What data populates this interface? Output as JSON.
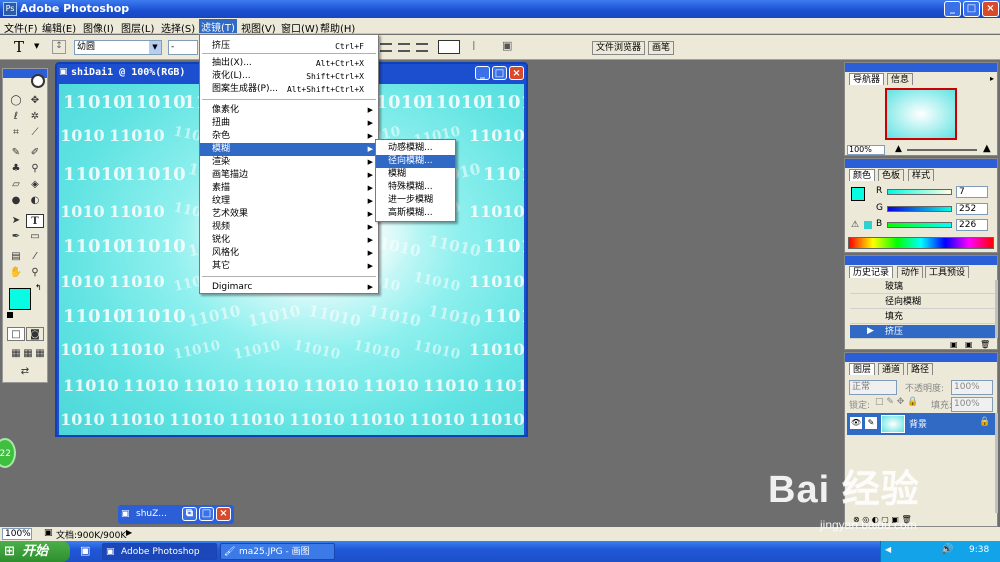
{
  "window": {
    "title": "Adobe Photoshop",
    "icon": "photoshop-icon"
  },
  "menubar": [
    "文件(F)",
    "编辑(E)",
    "图像(I)",
    "图层(L)",
    "选择(S)",
    "滤镜(T)",
    "视图(V)",
    "窗口(W)",
    "帮助(H)"
  ],
  "optionsbar": {
    "tool_glyph": "T",
    "font_family": "幼圆",
    "font_style": "-",
    "palette_tabs": [
      "文件浏览器",
      "画笔"
    ]
  },
  "document": {
    "title": "shiDai1 @ 100%(RGB)",
    "binary_text": "11010"
  },
  "filter_menu": {
    "items": [
      {
        "label": "挤压",
        "shortcut": "Ctrl+F"
      },
      {
        "label": "抽出(X)...",
        "shortcut": "Alt+Ctrl+X"
      },
      {
        "label": "液化(L)...",
        "shortcut": "Shift+Ctrl+X"
      },
      {
        "label": "图案生成器(P)...",
        "shortcut": "Alt+Shift+Ctrl+X"
      },
      {
        "label": "像素化"
      },
      {
        "label": "扭曲"
      },
      {
        "label": "杂色"
      },
      {
        "label": "模糊"
      },
      {
        "label": "渲染"
      },
      {
        "label": "画笔描边"
      },
      {
        "label": "素描"
      },
      {
        "label": "纹理"
      },
      {
        "label": "艺术效果"
      },
      {
        "label": "视频"
      },
      {
        "label": "锐化"
      },
      {
        "label": "风格化"
      },
      {
        "label": "其它"
      },
      {
        "label": "Digimarc"
      }
    ]
  },
  "blur_submenu": [
    "动感模糊...",
    "径向模糊...",
    "模糊",
    "特殊模糊...",
    "进一步模糊",
    "高斯模糊..."
  ],
  "navigator": {
    "tabs": [
      "导航器",
      "信息"
    ],
    "zoom": "100%"
  },
  "color": {
    "tabs": [
      "颜色",
      "色板",
      "样式"
    ],
    "r_label": "R",
    "g_label": "G",
    "b_label": "B",
    "r": "7",
    "g": "252",
    "b": "226",
    "foreground": "#07fce2"
  },
  "history": {
    "tabs": [
      "历史记录",
      "动作",
      "工具预设"
    ],
    "items": [
      "玻璃",
      "径向模糊",
      "填充",
      "挤压"
    ]
  },
  "layers": {
    "tabs": [
      "图层",
      "通道",
      "路径"
    ],
    "blend_mode": "正常",
    "opacity_label": "不透明度:",
    "opacity": "100%",
    "lock_label": "锁定:",
    "fill_label": "填充:",
    "fill": "100%",
    "layer_name": "背景"
  },
  "minimized_doc": {
    "title": "shuZ..."
  },
  "statusbar": {
    "zoom": "100%",
    "doc_info": "文档:900K/900K"
  },
  "taskbar": {
    "start": "开始",
    "tasks": [
      "Adobe Photoshop",
      "ma25.JPG - 画图"
    ],
    "time": "9:38"
  },
  "badge": "22",
  "watermark": {
    "main": "Bai 经验",
    "url": "jingyan.baidu.com"
  }
}
